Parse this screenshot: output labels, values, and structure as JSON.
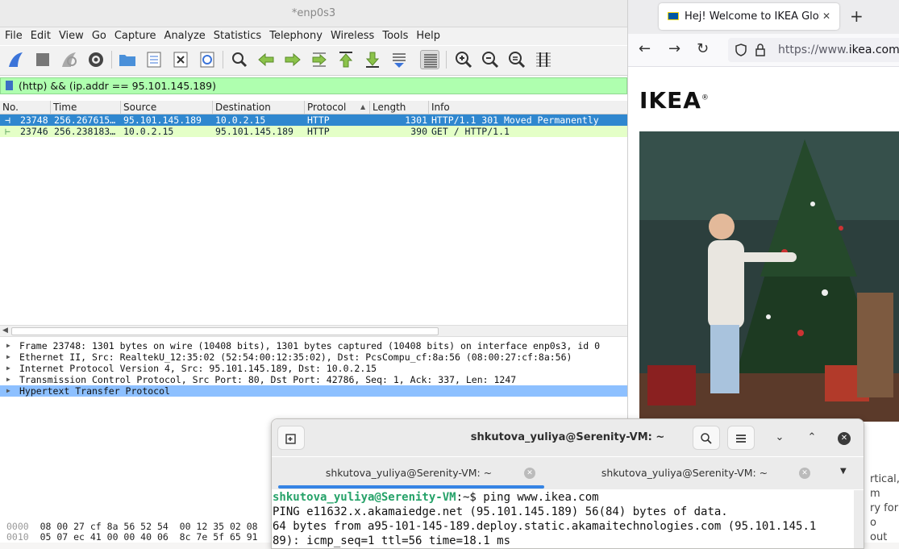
{
  "wireshark": {
    "title": "*enp0s3",
    "menu": [
      "File",
      "Edit",
      "View",
      "Go",
      "Capture",
      "Analyze",
      "Statistics",
      "Telephony",
      "Wireless",
      "Tools",
      "Help"
    ],
    "filter": "(http) && (ip.addr == 95.101.145.189)",
    "columns": [
      "No.",
      "Time",
      "Source",
      "Destination",
      "Protocol",
      "Length",
      "Info"
    ],
    "packets": [
      {
        "no": "23748",
        "time": "256.267615…",
        "src": "95.101.145.189",
        "dst": "10.0.2.15",
        "proto": "HTTP",
        "len": "1301",
        "info": "HTTP/1.1 301 Moved Permanently"
      },
      {
        "no": "23746",
        "time": "256.238183…",
        "src": "10.0.2.15",
        "dst": "95.101.145.189",
        "proto": "HTTP",
        "len": "390",
        "info": "GET / HTTP/1.1"
      }
    ],
    "details": [
      "Frame 23748: 1301 bytes on wire (10408 bits), 1301 bytes captured (10408 bits) on interface enp0s3, id 0",
      "Ethernet II, Src: RealtekU_12:35:02 (52:54:00:12:35:02), Dst: PcsCompu_cf:8a:56 (08:00:27:cf:8a:56)",
      "Internet Protocol Version 4, Src: 95.101.145.189, Dst: 10.0.2.15",
      "Transmission Control Protocol, Src Port: 80, Dst Port: 42786, Seq: 1, Ack: 337, Len: 1247",
      "Hypertext Transfer Protocol"
    ],
    "hex": [
      {
        "off": "0000",
        "bytes": "08 00 27 cf 8a 56 52 54  00 12 35 02 08"
      },
      {
        "off": "0010",
        "bytes": "05 07 ec 41 00 00 40 06  8c 7e 5f 65 91"
      }
    ]
  },
  "firefox": {
    "tab_title": "Hej! Welcome to IKEA Glob",
    "url_prefix": "https://www.",
    "url_domain": "ikea.com",
    "logo": "IKEA",
    "peek_lines": [
      "rtical, m",
      "ry for o",
      "out how"
    ]
  },
  "terminal": {
    "title": "shkutova_yuliya@Serenity-VM: ~",
    "tabs": [
      "shkutova_yuliya@Serenity-VM: ~",
      "shkutova_yuliya@Serenity-VM: ~"
    ],
    "prompt_user": "shkutova_yuliya@Serenity-VM",
    "prompt_rest": ":~$ ping www.ikea.com",
    "lines": [
      "PING e11632.x.akamaiedge.net (95.101.145.189) 56(84) bytes of data.",
      "64 bytes from a95-101-145-189.deploy.static.akamaitechnologies.com (95.101.145.1",
      "89): icmp_seq=1 ttl=56 time=18.1 ms"
    ]
  }
}
